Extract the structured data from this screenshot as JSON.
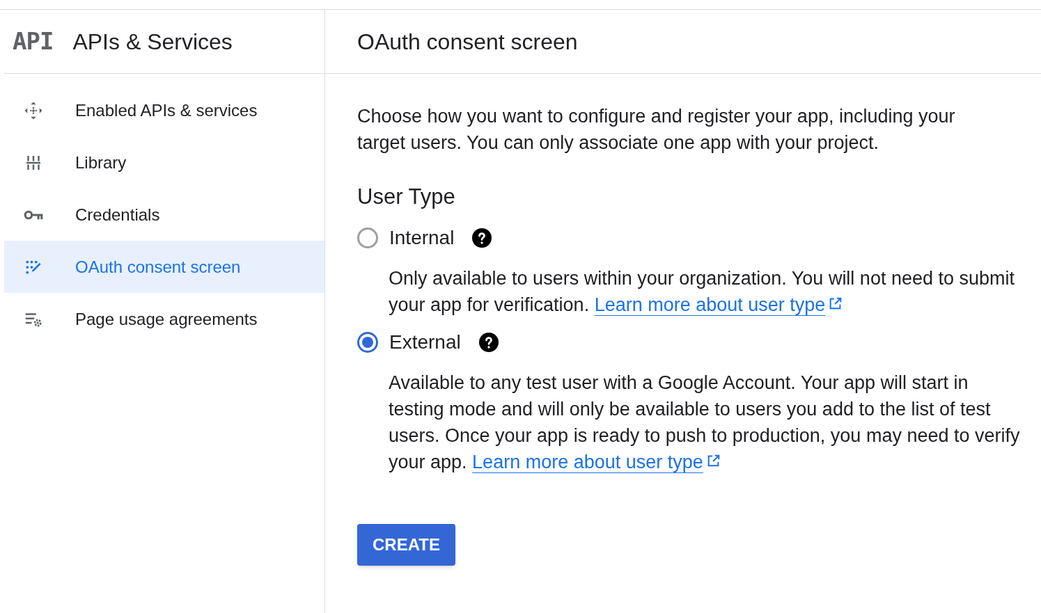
{
  "sidebar": {
    "logo": "API",
    "title": "APIs & Services",
    "items": [
      {
        "kind": "enabled",
        "label": "Enabled APIs & services",
        "selected": false
      },
      {
        "kind": "library",
        "label": "Library",
        "selected": false
      },
      {
        "kind": "credentials",
        "label": "Credentials",
        "selected": false
      },
      {
        "kind": "consent",
        "label": "OAuth consent screen",
        "selected": true
      },
      {
        "kind": "agreements",
        "label": "Page usage agreements",
        "selected": false
      }
    ]
  },
  "main": {
    "title": "OAuth consent screen",
    "intro": "Choose how you want to configure and register your app, including your target users. You can only associate one app with your project.",
    "section_title": "User Type",
    "options": [
      {
        "label": "Internal",
        "selected": false,
        "description": "Only available to users within your organization. You will not need to submit your app for verification.",
        "link": "Learn more about user type"
      },
      {
        "label": "External",
        "selected": true,
        "description": "Available to any test user with a Google Account. Your app will start in testing mode and will only be available to users you add to the list of test users. Once your app is ready to push to production, you may need to verify your app.",
        "link": "Learn more about user type"
      }
    ],
    "button": "CREATE"
  }
}
